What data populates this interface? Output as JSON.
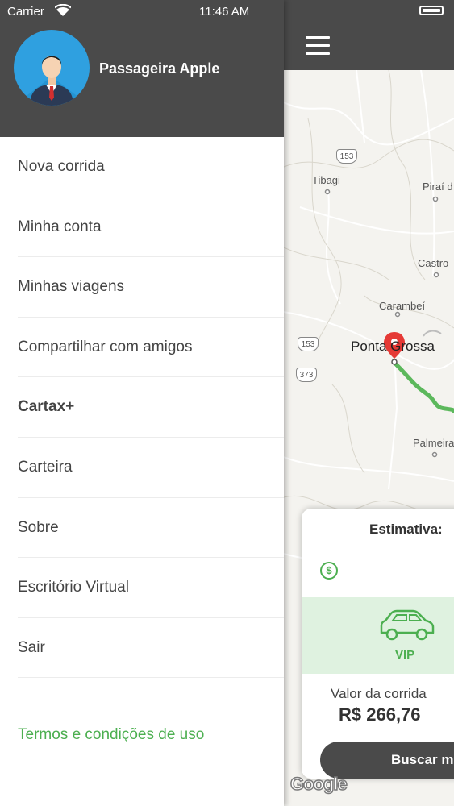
{
  "status_bar": {
    "carrier": "Carrier",
    "time": "11:46 AM"
  },
  "user": {
    "name": "Passageira Apple"
  },
  "menu": {
    "items": [
      {
        "label": "Nova corrida"
      },
      {
        "label": "Minha conta"
      },
      {
        "label": "Minhas viagens"
      },
      {
        "label": "Compartilhar com amigos"
      },
      {
        "label": "Cartax+"
      },
      {
        "label": "Carteira"
      },
      {
        "label": "Sobre"
      },
      {
        "label": "Escritório Virtual"
      },
      {
        "label": "Sair"
      }
    ],
    "terms_link": "Termos e condições de uso"
  },
  "map": {
    "places": {
      "tibagi": "Tibagi",
      "pirai": "Piraí d",
      "castro": "Castro",
      "carambei": "Carambeí",
      "ponta_grossa": "Ponta Grossa",
      "palmeira": "Palmeira"
    },
    "highways": {
      "h153_top": "153",
      "h153_mid": "153",
      "h373": "373"
    },
    "attribution": "Google",
    "route_color": "#5cb85c",
    "pin_color": "#e53935"
  },
  "estimate": {
    "title": "Estimativa:",
    "currency_symbol": "$",
    "vehicle_label": "VIP",
    "fare_label": "Valor da corrida",
    "fare_value": "R$ 266,76",
    "search_button": "Buscar m"
  },
  "colors": {
    "header": "#4a4a4a",
    "accent": "#4caf50",
    "avatar_bg": "#2fa0e0"
  }
}
